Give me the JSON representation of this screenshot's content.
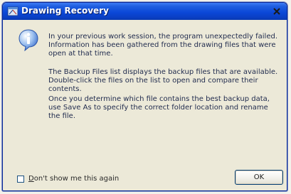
{
  "window": {
    "title": "Drawing Recovery",
    "title_color": "#ffffff",
    "titlebar_color": "#0b48d8",
    "background_color": "#ece9d8"
  },
  "icons": {
    "app": "drawing-recovery-app-icon",
    "info": "information-icon",
    "close": "close-icon"
  },
  "message": {
    "paragraph_1": "In your previous work session, the program unexpectedly failed. Information has been gathered from the drawing files that were open at that time.",
    "paragraph_2": "The Backup Files list displays the backup files that are available. Double-click the files on the list to open and compare their contents.",
    "paragraph_3": "Once you determine which file contains the best backup data, use Save As to specify the correct folder location and rename the file."
  },
  "checkbox": {
    "label_mnemonic": "D",
    "label_rest": "on't show me this again",
    "checked": false
  },
  "buttons": {
    "ok_label": "OK"
  }
}
